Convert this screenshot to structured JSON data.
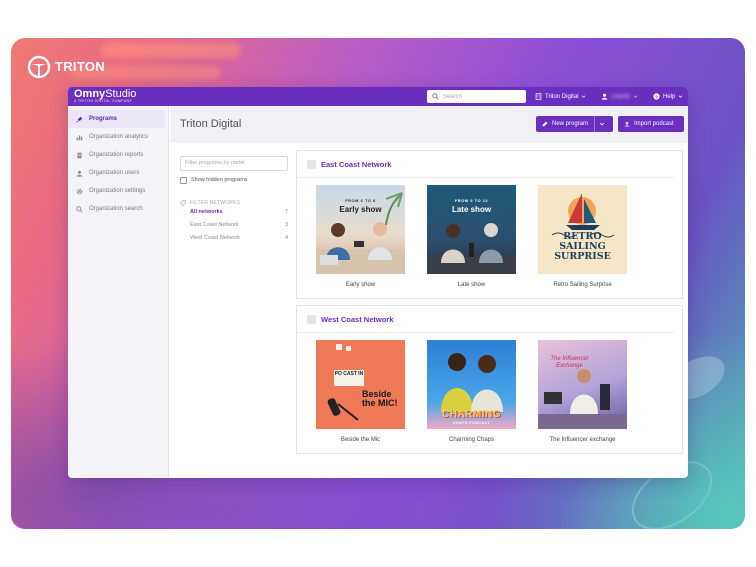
{
  "brand": {
    "name": "TRITON"
  },
  "app": {
    "logo": "Omny",
    "logo_studio": "Studio",
    "logo_sub": "A TRITON DIGITAL COMPANY",
    "search_placeholder": "Search",
    "org_menu": "Triton Digital",
    "user_menu": "Charlie",
    "help_menu": "Help"
  },
  "sidebar": {
    "items": [
      {
        "label": "Programs",
        "icon": "microphone-icon"
      },
      {
        "label": "Organization analytics",
        "icon": "bar-chart-icon"
      },
      {
        "label": "Organization reports",
        "icon": "document-icon"
      },
      {
        "label": "Organization users",
        "icon": "user-icon"
      },
      {
        "label": "Organization settings",
        "icon": "gear-icon"
      },
      {
        "label": "Organization search",
        "icon": "search-icon"
      }
    ]
  },
  "page": {
    "title": "Triton Digital",
    "new_program": "New program",
    "import_podcast": "Import podcast"
  },
  "filters": {
    "placeholder": "Filter programs by name",
    "show_hidden": "Show hidden programs",
    "heading": "FILTER NETWORKS",
    "networks": [
      {
        "label": "All networks",
        "count": "7"
      },
      {
        "label": "East Coast Network",
        "count": "3"
      },
      {
        "label": "West Coast Network",
        "count": "4"
      }
    ]
  },
  "networks": [
    {
      "title": "East Coast Network",
      "programs": [
        {
          "name": "Early show",
          "cover_text": "Early show",
          "cover_top": "FROM 6 TO 8"
        },
        {
          "name": "Late show",
          "cover_text": "Late show",
          "cover_top": "FROM 9 TO 12"
        },
        {
          "name": "Retro Sailing Surprise",
          "cover_text": "RETRO SAILING SURPRISE"
        }
      ]
    },
    {
      "title": "West Coast Network",
      "programs": [
        {
          "name": "Beside the Mic",
          "cover_text": "Beside the MIC!",
          "cover_top": "PO CAST IN"
        },
        {
          "name": "Charming Chaps",
          "cover_text": "CHARMING",
          "cover_sub": "CHAPS PODCAST"
        },
        {
          "name": "The Influencer exchange",
          "cover_text": "The Influencer Exchange"
        }
      ]
    }
  ],
  "colors": {
    "accent": "#6a2fbf",
    "sidebar_bg": "#f4f3f7"
  }
}
